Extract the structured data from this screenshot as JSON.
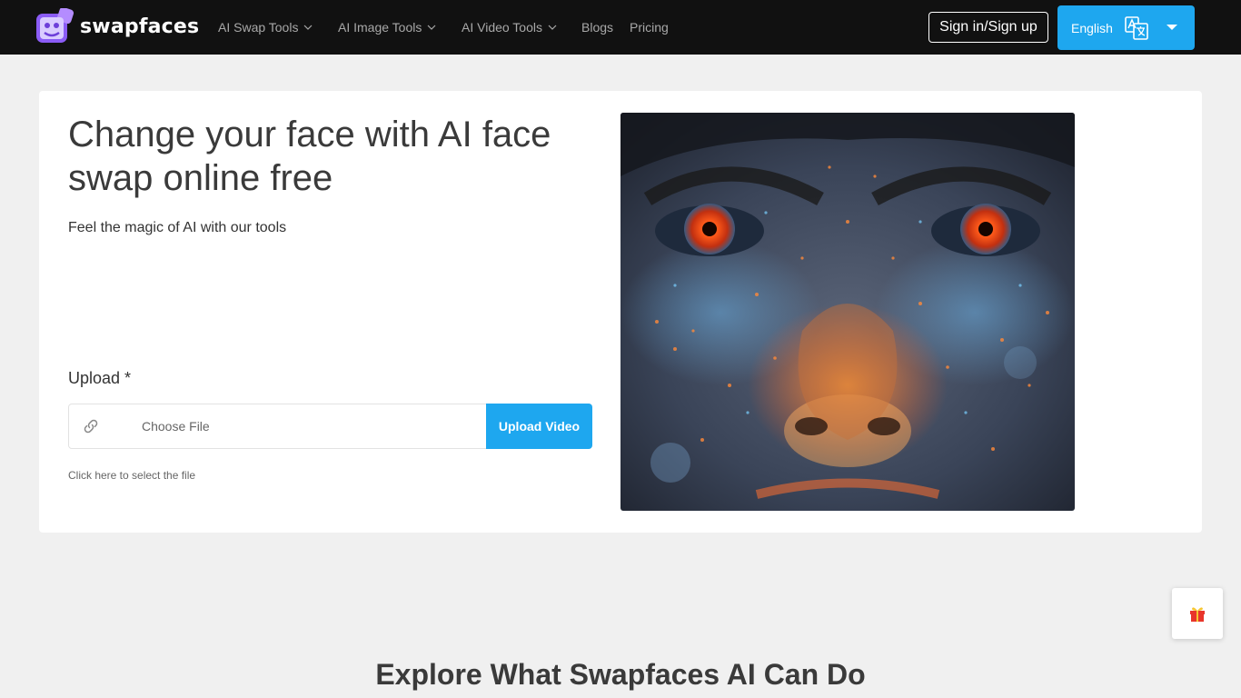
{
  "header": {
    "brand": "swapfaces",
    "nav": [
      {
        "label": "AI Swap Tools",
        "dropdown": true
      },
      {
        "label": "AI Image Tools",
        "dropdown": true
      },
      {
        "label": "AI Video Tools",
        "dropdown": true
      },
      {
        "label": "Blogs",
        "dropdown": false
      },
      {
        "label": "Pricing",
        "dropdown": false
      }
    ],
    "signin_label": "Sign in/Sign up",
    "language_label": "English"
  },
  "hero": {
    "title": "Change your face with AI face swap online free",
    "subtitle": "Feel the magic of AI with our tools",
    "upload_label": "Upload *",
    "file_placeholder": "Choose File",
    "upload_button": "Upload Video",
    "hint": "Click here to select the file"
  },
  "explore": {
    "title": "Explore What Swapfaces AI Can Do"
  },
  "colors": {
    "accent": "#1ea7ef",
    "header_bg": "#111111",
    "page_bg": "#f0f0f0",
    "logo_purple": "#8b5cf6"
  },
  "icons": [
    "logo-icon",
    "chevron-down-icon",
    "translate-icon",
    "caret-down-icon",
    "link-icon",
    "gift-icon"
  ]
}
